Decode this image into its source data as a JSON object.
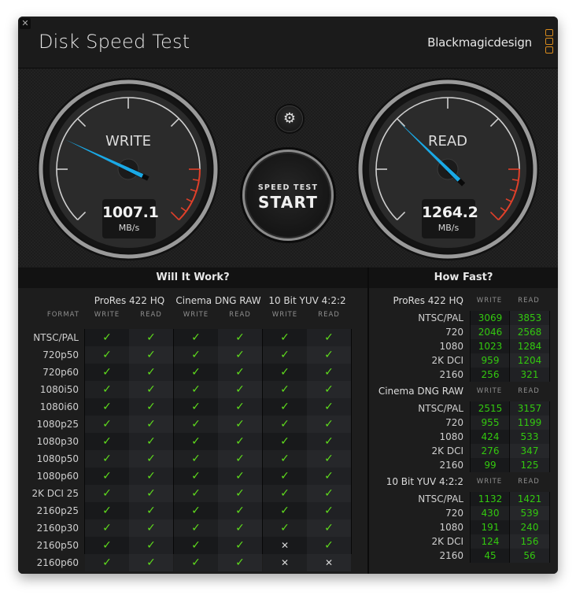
{
  "window": {
    "title": "Disk Speed Test",
    "brand": "Blackmagicdesign",
    "close_icon": "close-icon"
  },
  "gauges": {
    "write": {
      "label": "WRITE",
      "value": "1007.1",
      "unit": "MB/s",
      "needle_fraction": 0.26
    },
    "read": {
      "label": "READ",
      "value": "1264.2",
      "unit": "MB/s",
      "needle_fraction": 0.33
    }
  },
  "controls": {
    "settings_icon": "gear-icon",
    "start_small": "SPEED TEST",
    "start_big": "START"
  },
  "colors": {
    "check": "#5fdc1d",
    "value_green": "#33c90f",
    "needle": "#1aa9e6",
    "redline": "#e0402a",
    "brand_orange": "#d98b1c"
  },
  "will_it_work": {
    "title": "Will It Work?",
    "format_label": "FORMAT",
    "codecs": [
      "ProRes 422 HQ",
      "Cinema DNG RAW",
      "10 Bit YUV 4:2:2"
    ],
    "sub_labels": [
      "WRITE",
      "READ"
    ],
    "rows": [
      {
        "format": "NTSC/PAL",
        "cells": [
          1,
          1,
          1,
          1,
          1,
          1
        ]
      },
      {
        "format": "720p50",
        "cells": [
          1,
          1,
          1,
          1,
          1,
          1
        ]
      },
      {
        "format": "720p60",
        "cells": [
          1,
          1,
          1,
          1,
          1,
          1
        ]
      },
      {
        "format": "1080i50",
        "cells": [
          1,
          1,
          1,
          1,
          1,
          1
        ]
      },
      {
        "format": "1080i60",
        "cells": [
          1,
          1,
          1,
          1,
          1,
          1
        ]
      },
      {
        "format": "1080p25",
        "cells": [
          1,
          1,
          1,
          1,
          1,
          1
        ]
      },
      {
        "format": "1080p30",
        "cells": [
          1,
          1,
          1,
          1,
          1,
          1
        ]
      },
      {
        "format": "1080p50",
        "cells": [
          1,
          1,
          1,
          1,
          1,
          1
        ]
      },
      {
        "format": "1080p60",
        "cells": [
          1,
          1,
          1,
          1,
          1,
          1
        ]
      },
      {
        "format": "2K DCI 25",
        "cells": [
          1,
          1,
          1,
          1,
          1,
          1
        ]
      },
      {
        "format": "2160p25",
        "cells": [
          1,
          1,
          1,
          1,
          1,
          1
        ]
      },
      {
        "format": "2160p30",
        "cells": [
          1,
          1,
          1,
          1,
          1,
          1
        ]
      },
      {
        "format": "2160p50",
        "cells": [
          1,
          1,
          1,
          1,
          0,
          1
        ]
      },
      {
        "format": "2160p60",
        "cells": [
          1,
          1,
          1,
          1,
          0,
          0
        ]
      }
    ],
    "ok_glyph": "✓",
    "no_glyph": "✕"
  },
  "how_fast": {
    "title": "How Fast?",
    "sub_labels": [
      "WRITE",
      "READ"
    ],
    "groups": [
      {
        "codec": "ProRes 422 HQ",
        "rows": [
          {
            "label": "NTSC/PAL",
            "write": "3069",
            "read": "3853"
          },
          {
            "label": "720",
            "write": "2046",
            "read": "2568"
          },
          {
            "label": "1080",
            "write": "1023",
            "read": "1284"
          },
          {
            "label": "2K DCI",
            "write": "959",
            "read": "1204"
          },
          {
            "label": "2160",
            "write": "256",
            "read": "321"
          }
        ]
      },
      {
        "codec": "Cinema DNG RAW",
        "rows": [
          {
            "label": "NTSC/PAL",
            "write": "2515",
            "read": "3157"
          },
          {
            "label": "720",
            "write": "955",
            "read": "1199"
          },
          {
            "label": "1080",
            "write": "424",
            "read": "533"
          },
          {
            "label": "2K DCI",
            "write": "276",
            "read": "347"
          },
          {
            "label": "2160",
            "write": "99",
            "read": "125"
          }
        ]
      },
      {
        "codec": "10 Bit YUV 4:2:2",
        "rows": [
          {
            "label": "NTSC/PAL",
            "write": "1132",
            "read": "1421"
          },
          {
            "label": "720",
            "write": "430",
            "read": "539"
          },
          {
            "label": "1080",
            "write": "191",
            "read": "240"
          },
          {
            "label": "2K DCI",
            "write": "124",
            "read": "156"
          },
          {
            "label": "2160",
            "write": "45",
            "read": "56"
          }
        ]
      }
    ]
  }
}
